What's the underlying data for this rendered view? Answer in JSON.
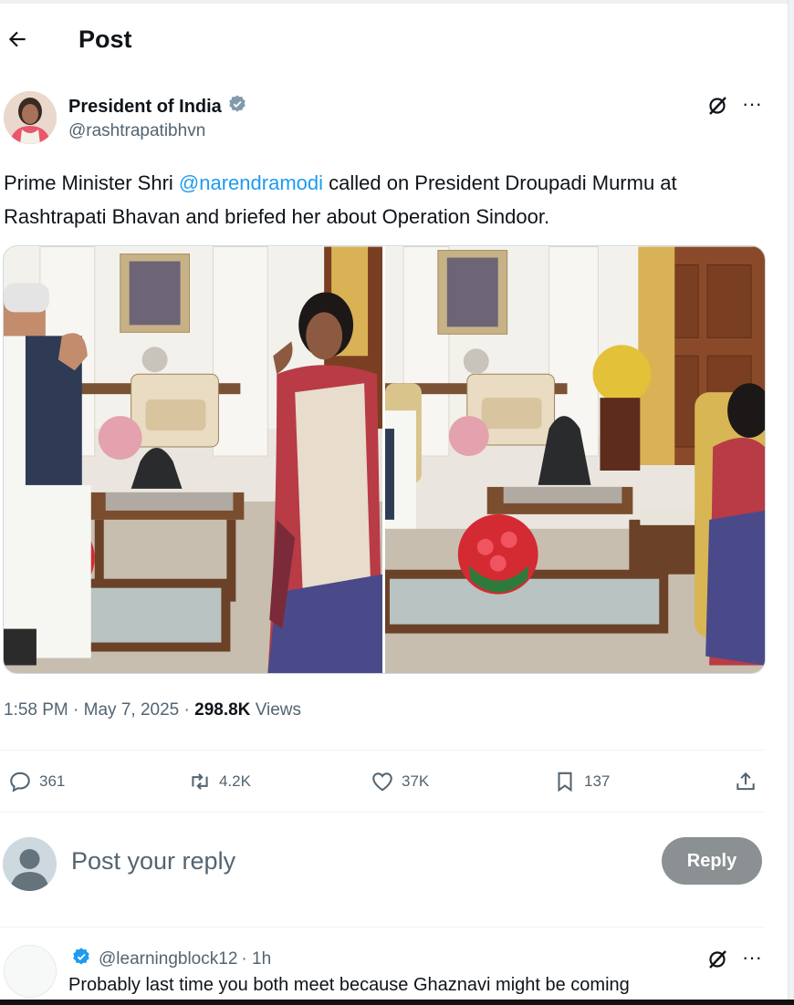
{
  "header": {
    "title": "Post",
    "back_icon": "arrow-left-icon"
  },
  "post": {
    "author_name": "President of India",
    "handle": "@rashtrapatibhvn",
    "verified_color": "#829aab",
    "text_prefix": "Prime Minister Shri ",
    "mention": "@narendramodi",
    "text_suffix": " called on President Droupadi Murmu at Rashtrapati Bhavan and briefed her about Operation Sindoor.",
    "time": "1:58 PM",
    "date": "May 7, 2025",
    "views_count": "298.8K",
    "views_label": "Views",
    "separator": "·"
  },
  "actions": {
    "replies": "361",
    "reposts": "4.2K",
    "likes": "37K",
    "bookmarks": "137"
  },
  "reply_box": {
    "placeholder": "Post your reply",
    "button_label": "Reply"
  },
  "comment": {
    "handle": "@learningblock12",
    "time": "· 1h",
    "text": "Probably last time you both meet because Ghaznavi might be coming"
  },
  "colors": {
    "accent": "#1d9bf0",
    "muted": "#536471",
    "text": "#0f1419",
    "reply_button": "#8b9093"
  }
}
